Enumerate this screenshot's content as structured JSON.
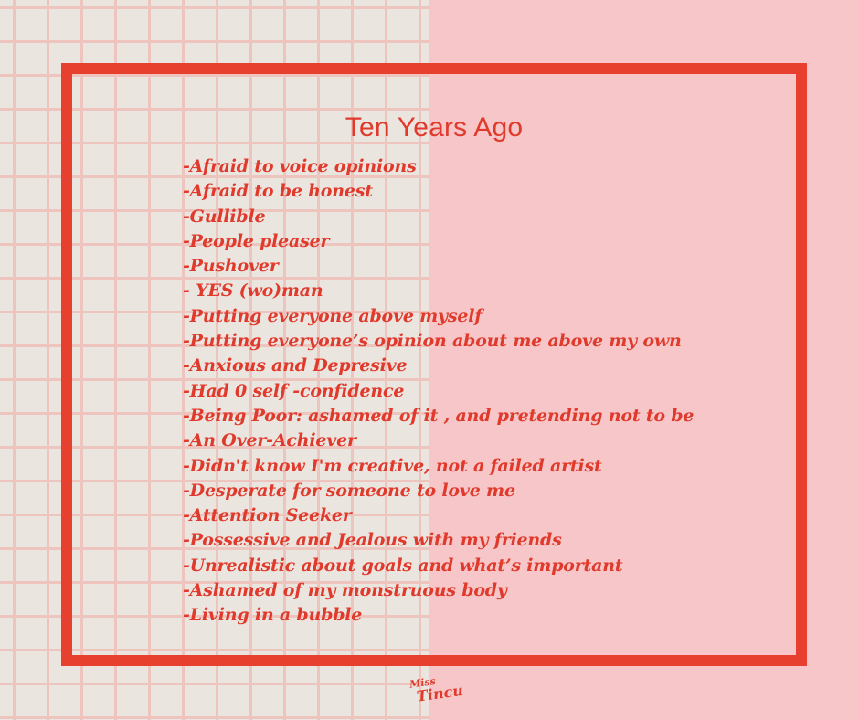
{
  "title": "Ten Years Ago",
  "items": [
    "-Afraid to voice opinions",
    "-Afraid to be honest",
    "-Gullible",
    "-People pleaser",
    "-Pushover",
    "- YES (wo)man",
    "-Putting everyone above myself",
    "-Putting everyone’s opinion about me above my own",
    "-Anxious and Depresive",
    "-Had 0 self -confidence",
    "-Being Poor: ashamed of it , and pretending not to be",
    "-An Over-Achiever",
    "-Didn't know I'm creative, not a failed artist",
    "-Desperate for someone to love me",
    "-Attention Seeker",
    "-Possessive and Jealous with my friends",
    "-Unrealistic about goals and what’s important",
    "-Ashamed of my monstruous body",
    "-Living in a bubble"
  ],
  "signature": {
    "line1": "Miss",
    "line2": "Tincu"
  },
  "colors": {
    "accent": "#e8402e",
    "text": "#e03a2c",
    "pink": "#f6c6c8",
    "grid_bg": "#ebe5e0",
    "grid_lines": "#eec4bf"
  }
}
